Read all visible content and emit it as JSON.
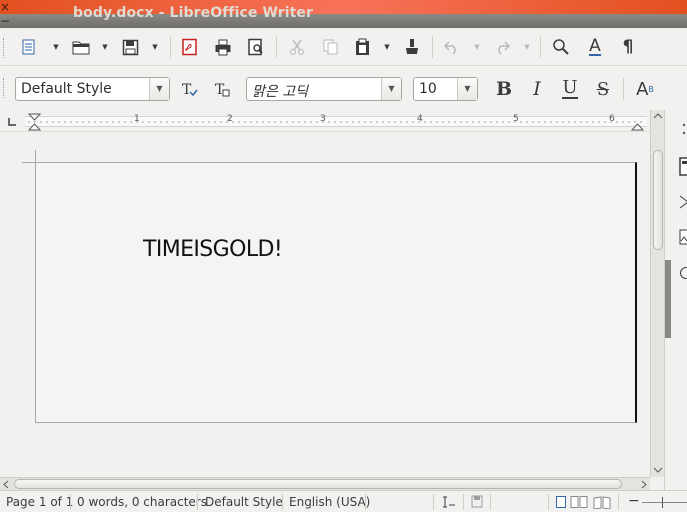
{
  "window": {
    "title": "body.docx - LibreOffice Writer",
    "close_glyph": "×",
    "minimize_glyph": "−",
    "maximize_glyph": "□"
  },
  "standard_toolbar": {
    "icons": [
      "new-document-icon",
      "templates-icon",
      "open-icon",
      "save-icon",
      "export-pdf-icon",
      "print-icon",
      "print-preview-icon",
      "cut-icon",
      "copy-icon",
      "paste-icon",
      "clone-formatting-icon",
      "undo-icon",
      "redo-icon",
      "find-replace-icon",
      "spelling-icon",
      "formatting-marks-icon"
    ],
    "spelling_glyph": "A",
    "formatting_marks_glyph": "¶"
  },
  "formatting_toolbar": {
    "paragraph_style": "Default Style",
    "font_name": "맑은 고딕",
    "font_size": "10",
    "bold_glyph": "B",
    "italic_glyph": "I",
    "underline_glyph": "U",
    "strike_glyph": "S",
    "superscript_glyph": "A"
  },
  "ruler": {
    "numbers": [
      "1",
      "2",
      "3",
      "4",
      "5",
      "6"
    ]
  },
  "document": {
    "text": "TIMEISGOLD!"
  },
  "statusbar": {
    "page": "Page 1 of 1",
    "word_count": "0 words, 0 characters",
    "page_style": "Default Style",
    "language": "English (USA)"
  },
  "colors": {
    "titlebar": "#3c3b37",
    "close_button": "#e2501f",
    "page_background": "#f4f4f4"
  }
}
